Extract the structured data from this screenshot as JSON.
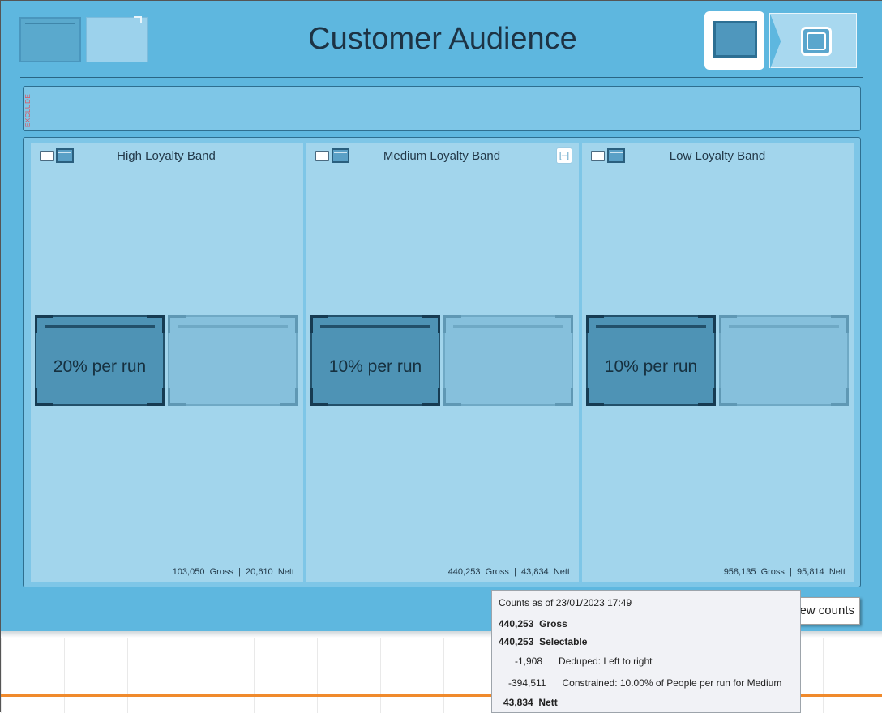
{
  "header": {
    "title": "Customer Audience"
  },
  "exclude_panel": {
    "label": "EXCLUDE"
  },
  "bands": [
    {
      "title": "High Loyalty Band",
      "segment_label": "20% per run",
      "gross": "103,050",
      "gross_label": "Gross",
      "separator": "|",
      "nett": "20,610",
      "nett_label": "Nett"
    },
    {
      "title": "Medium Loyalty Band",
      "segment_label": "10% per run",
      "gross": "440,253",
      "gross_label": "Gross",
      "separator": "|",
      "nett": "43,834",
      "nett_label": "Nett"
    },
    {
      "title": "Low Loyalty Band",
      "segment_label": "10% per run",
      "gross": "958,135",
      "gross_label": "Gross",
      "separator": "|",
      "nett": "95,814",
      "nett_label": "Nett"
    }
  ],
  "view_counts_button": {
    "label": "ew counts"
  },
  "tooltip": {
    "heading": "Counts as of 23/01/2023 17:49",
    "gross_value": "440,253",
    "gross_label": "Gross",
    "selectable_value": "440,253",
    "selectable_label": "Selectable",
    "deduped_value": "-1,908",
    "deduped_label": "Deduped: Left to right",
    "constrained_value": "-394,511",
    "constrained_label": "Constrained: 10.00% of People per run for Medium",
    "nett_value": "43,834",
    "nett_label": "Nett"
  },
  "colors": {
    "canvas": "#5eb7df",
    "band_bg": "#a2d5ec",
    "segment_selected": "#4e93b5",
    "segment_unselected": "#86c0dc",
    "divider_orange": "#f08a2c",
    "exclude_label": "#e0505a"
  },
  "icons": {
    "band_icon": "page-and-block-icon",
    "collapse": "collapse-brackets-icon",
    "nav_current": "single-box-view-icon",
    "nav_next": "rounded-box-view-icon"
  }
}
